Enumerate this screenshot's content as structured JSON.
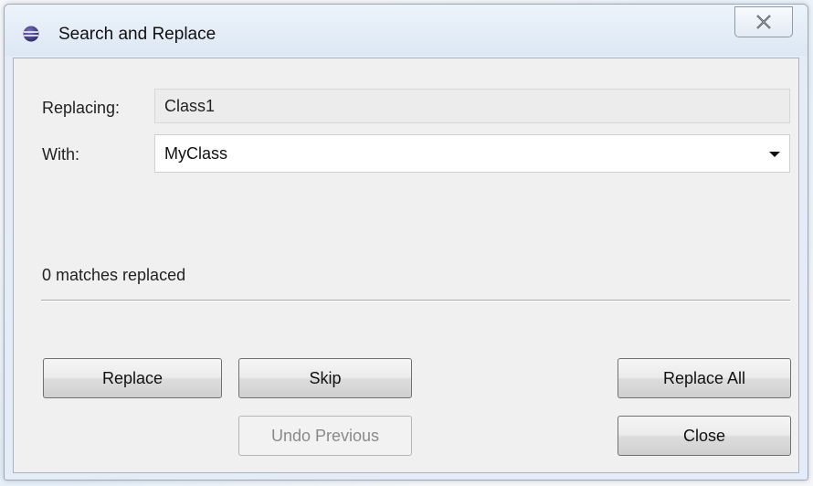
{
  "window": {
    "title": "Search and Replace",
    "close_icon": "close-x-icon",
    "app_icon": "eclipse-icon"
  },
  "form": {
    "replacing_label": "Replacing:",
    "replacing_value": "Class1",
    "with_label": "With:",
    "with_value": "MyClass",
    "dropdown_icon": "chevron-down-icon"
  },
  "status": {
    "text": "0 matches replaced"
  },
  "buttons": {
    "replace": "Replace",
    "skip": "Skip",
    "replace_all": "Replace All",
    "undo_previous": "Undo Previous",
    "close": "Close"
  },
  "colors": {
    "titlebar": "#e4edf7",
    "client_bg": "#f0f0f0",
    "disabled_text": "#8a8a8a"
  }
}
